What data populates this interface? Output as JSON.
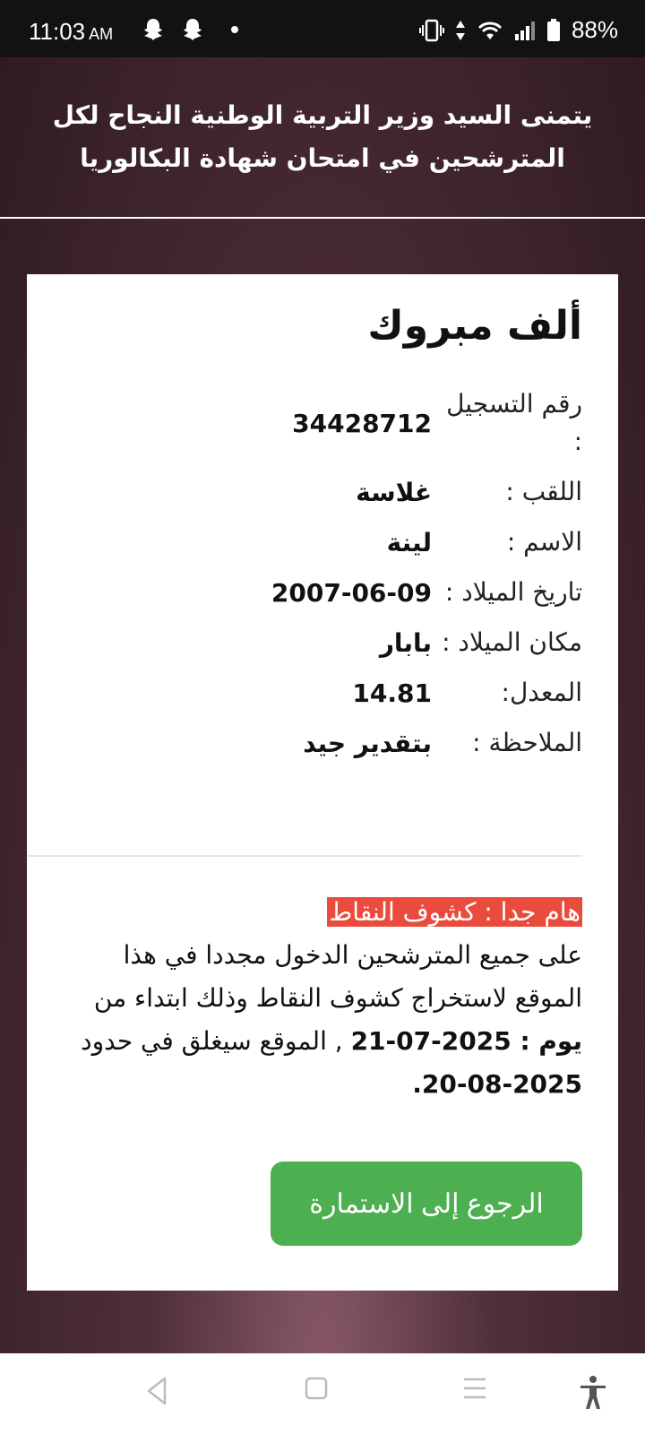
{
  "status_bar": {
    "time": "11:03",
    "ampm": "AM",
    "battery": "88%"
  },
  "header": {
    "message": "يتمنى السيد وزير التربية الوطنية النجاح لكل المترشحين في امتحان شهادة البكالوريا"
  },
  "card": {
    "title": "ألف مبروك",
    "fields": [
      {
        "label": "رقم التسجيل :",
        "value": "34428712"
      },
      {
        "label": "اللقب :",
        "value": "غلاسة"
      },
      {
        "label": "الاسم :",
        "value": "لينة"
      },
      {
        "label": "تاريخ الميلاد :",
        "value": "2007-06-09"
      },
      {
        "label": "مكان الميلاد :",
        "value": "بابار"
      },
      {
        "label": "المعدل:",
        "value": "14.81"
      },
      {
        "label": "الملاحظة :",
        "value": "بتقدير جيد"
      }
    ],
    "notice": {
      "tag": "هام جدا : كشوف النقاط",
      "line1": "على جميع المترشحين الدخول مجددا في هذا الموقع لاستخراج كشوف النقاط وذلك ابتداء من",
      "day_label": "يوم : 2025-07-21",
      "line2": " , الموقع سيغلق في حدود",
      "end_date": "2025-08-20."
    },
    "back_button_label": "الرجوع إلى الاستمارة"
  },
  "colors": {
    "accent_green": "#4caf50",
    "notice_red": "#e94b3c",
    "background": "#4f2f3b"
  }
}
